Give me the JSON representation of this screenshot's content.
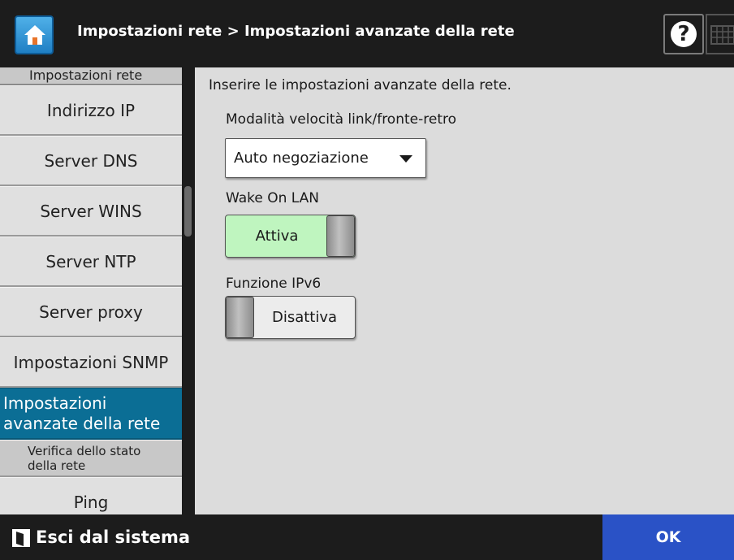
{
  "header": {
    "title": "Impostazioni rete > Impostazioni avanzate della rete",
    "home_icon": "home-icon",
    "help_symbol": "?",
    "keyboard_icon": "keyboard-icon"
  },
  "sidebar": {
    "section_header": "Impostazioni rete",
    "items": [
      {
        "label": "Indirizzo IP"
      },
      {
        "label": "Server DNS"
      },
      {
        "label": "Server WINS"
      },
      {
        "label": "Server NTP"
      },
      {
        "label": "Server proxy"
      },
      {
        "label": "Impostazioni SNMP"
      },
      {
        "label": "Impostazioni avanzate della rete",
        "active": true
      },
      {
        "label": "Verifica dello stato della rete"
      },
      {
        "label": "Ping"
      }
    ]
  },
  "main": {
    "instruction": "Inserire le impostazioni avanzate della rete.",
    "link_speed": {
      "label": "Modalità velocità link/fronte-retro",
      "value": "Auto negoziazione"
    },
    "wake_on_lan": {
      "label": "Wake On LAN",
      "state": "Attiva"
    },
    "ipv6": {
      "label": "Funzione IPv6",
      "state": "Disattiva"
    }
  },
  "footer": {
    "logout_label": "Esci dal sistema",
    "ok_label": "OK"
  },
  "colors": {
    "active_item": "#0b6e95",
    "toggle_on": "#bff5bf",
    "ok_button": "#2a52c6"
  }
}
